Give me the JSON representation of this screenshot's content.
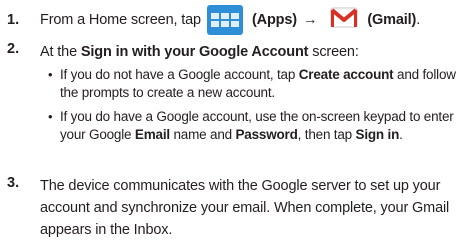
{
  "steps": [
    {
      "number": "1.",
      "text_before": "From a Home screen, tap",
      "apps_label": "(Apps)",
      "arrow": "→",
      "gmail_label": "(Gmail)",
      "end": "."
    },
    {
      "number": "2.",
      "intro_a": "At the ",
      "intro_bold": "Sign in with your Google Account",
      "intro_b": " screen:",
      "bullets": [
        {
          "a": "If you do not have a Google account, tap ",
          "bold1": "Create account",
          "b": " and follow the prompts to create a new account."
        },
        {
          "a": "If you do have a Google account, use the on-screen keypad to enter your Google ",
          "bold1": "Email",
          "b": " name and ",
          "bold2": "Password",
          "c": ", then tap ",
          "bold3": "Sign in",
          "d": "."
        }
      ]
    },
    {
      "number": "3.",
      "text": "The device communicates with the Google server to set up your account and synchronize your email. When complete, your Gmail appears in the Inbox."
    }
  ],
  "icons": {
    "apps": "apps-grid-icon",
    "gmail": "gmail-envelope-icon"
  },
  "colors": {
    "apps_icon": "#2e8fd6",
    "gmail_red": "#d93025"
  }
}
